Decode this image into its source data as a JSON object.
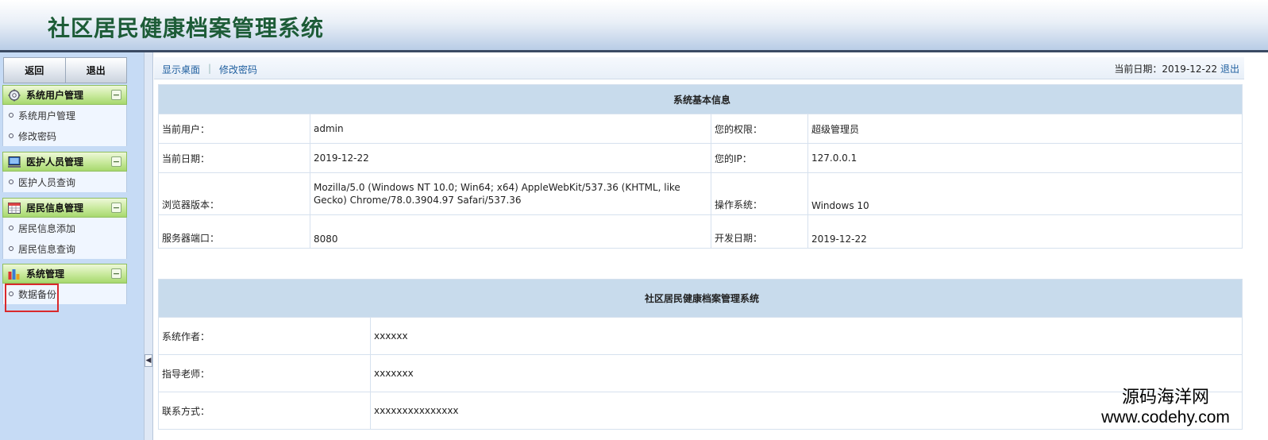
{
  "app": {
    "title": "社区居民健康档案管理系统"
  },
  "sidebar": {
    "buttons": {
      "back": "返回",
      "exit": "退出"
    },
    "groups": [
      {
        "title": "系统用户管理",
        "icon": "gear-icon",
        "items": [
          "系统用户管理",
          "修改密码"
        ]
      },
      {
        "title": "医护人员管理",
        "icon": "monitor-icon",
        "items": [
          "医护人员查询"
        ]
      },
      {
        "title": "居民信息管理",
        "icon": "calendar-icon",
        "items": [
          "居民信息添加",
          "居民信息查询"
        ]
      },
      {
        "title": "系统管理",
        "icon": "bar-chart-icon",
        "items": [
          "数据备份"
        ]
      }
    ],
    "collapse_glyph": "−"
  },
  "topbar": {
    "show_desktop": "显示桌面",
    "change_password": "修改密码",
    "date_label": "当前日期：",
    "date_value": "2019-12-22",
    "logout": "退出"
  },
  "system_info": {
    "title": "系统基本信息",
    "rows": [
      {
        "l1": "当前用户：",
        "v1": "admin",
        "l2": "您的权限：",
        "v2": "超级管理员"
      },
      {
        "l1": "当前日期：",
        "v1": "2019-12-22",
        "l2": "您的IP：",
        "v2": "127.0.0.1"
      },
      {
        "l1": "浏览器版本：",
        "v1": "Mozilla/5.0 (Windows NT 10.0; Win64; x64) AppleWebKit/537.36 (KHTML, like Gecko) Chrome/78.0.3904.97 Safari/537.36",
        "l2": "操作系统：",
        "v2": "Windows 10"
      },
      {
        "l1": "服务器端口：",
        "v1": "8080",
        "l2": "开发日期：",
        "v2": "2019-12-22"
      }
    ]
  },
  "about": {
    "title": "社区居民健康档案管理系统",
    "rows": [
      {
        "label": "系统作者：",
        "value": "xxxxxx"
      },
      {
        "label": "指导老师：",
        "value": "xxxxxxx"
      },
      {
        "label": "联系方式：",
        "value": "xxxxxxxxxxxxxxx"
      }
    ]
  },
  "watermark": {
    "line1": "源码海洋网",
    "line2": "www.codehy.com"
  },
  "colors": {
    "title_green": "#1d5c37",
    "link_blue": "#1f5f9f",
    "highlight_red": "#d9292b",
    "sidebar_bg": "#c6dbf5"
  }
}
